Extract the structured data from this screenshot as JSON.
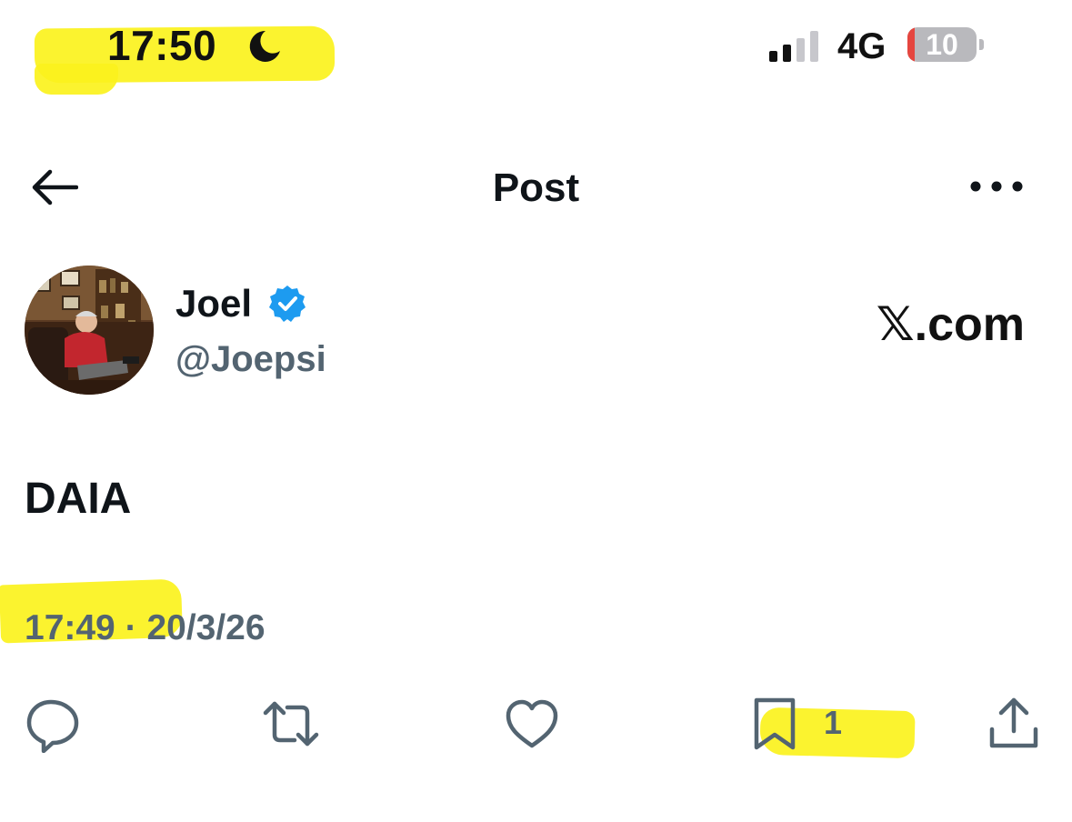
{
  "status_bar": {
    "time": "17:50",
    "network": "4G",
    "battery_level": "10",
    "battery_fraction": 0.1,
    "icons": [
      "moon-icon",
      "signal-icon",
      "battery-icon"
    ]
  },
  "header": {
    "title": "Post",
    "icons": [
      "back-arrow-icon",
      "more-icon"
    ]
  },
  "post": {
    "author_name": "Joel",
    "author_handle": "@Joepsi",
    "verified": true,
    "brand": "𝕏.com",
    "text": "DAIA",
    "time": "17:49",
    "separator": "·",
    "date": "20/3/26"
  },
  "actions": {
    "bookmark_count": "1",
    "icons": [
      "reply-icon",
      "repost-icon",
      "like-icon",
      "bookmark-icon",
      "share-icon"
    ]
  },
  "colors": {
    "text": "#0f1419",
    "secondary": "#536471",
    "verified": "#1d9bf0",
    "highlight": "#fbf21d",
    "battery_low": "#e5463f"
  }
}
